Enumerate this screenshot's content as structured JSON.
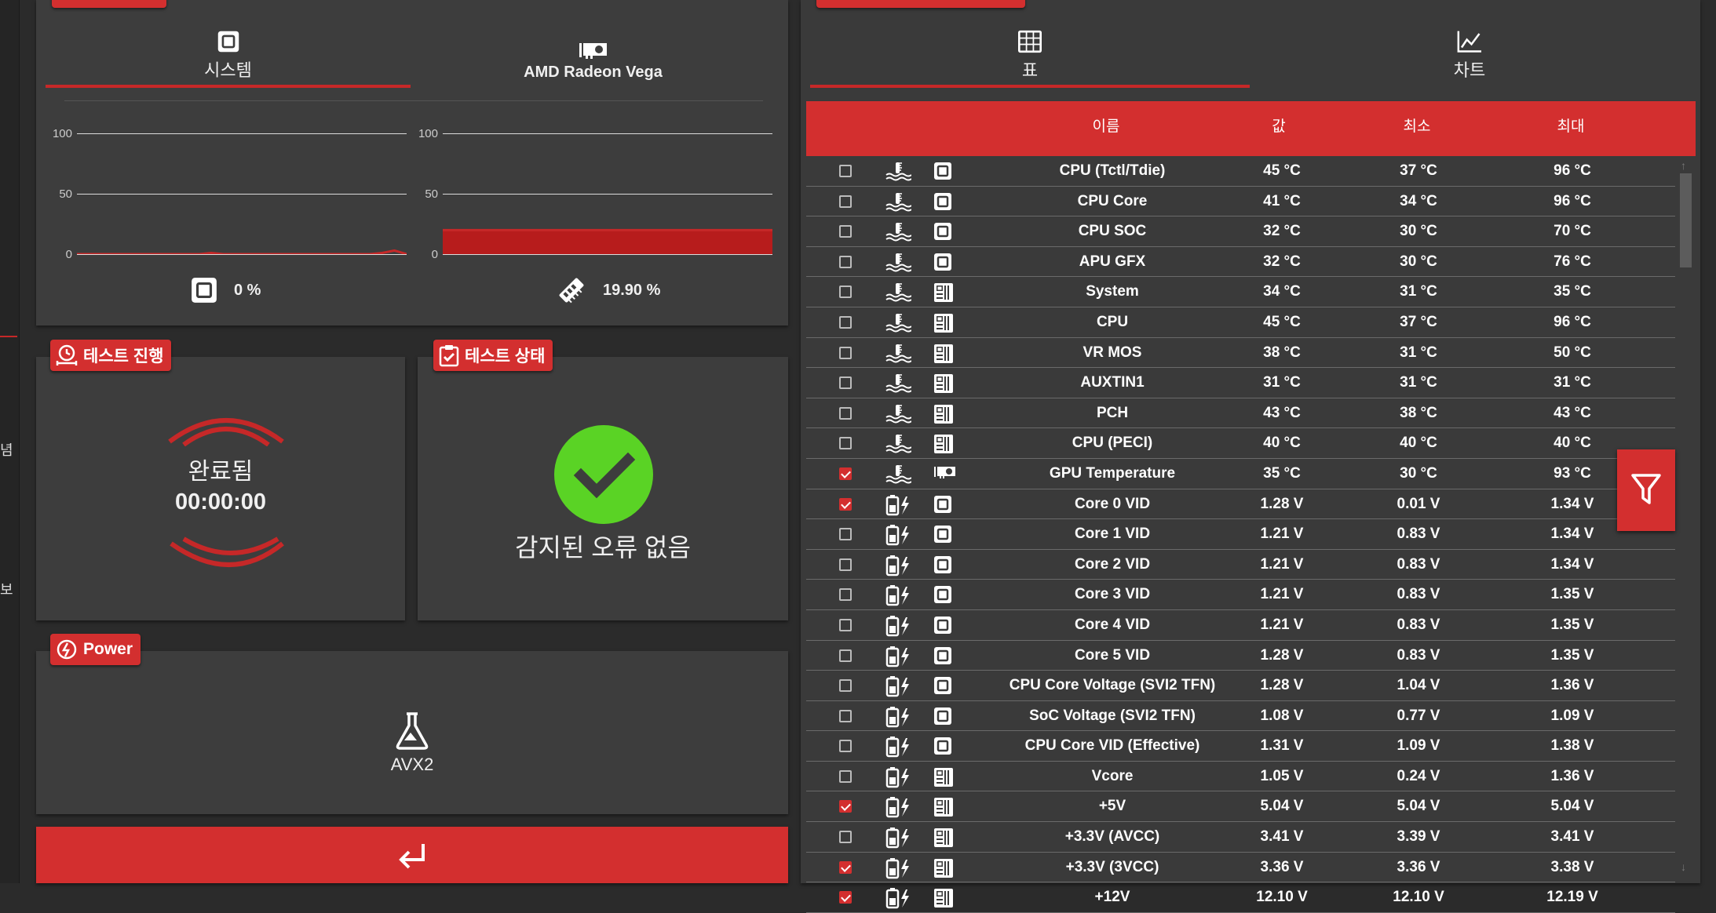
{
  "left_strip": {
    "chars": [
      "념",
      "보"
    ]
  },
  "monitor": {
    "tabs": [
      {
        "label": "시스템",
        "icon": "cpu-chip-icon",
        "active": true
      },
      {
        "label": "AMD Radeon Vega",
        "icon": "gpu-card-icon",
        "active": false
      }
    ],
    "chart_data": [
      {
        "type": "line",
        "yticks": [
          "100",
          "50",
          "0"
        ],
        "ylim": [
          0,
          100
        ],
        "values": [
          0,
          0,
          0,
          0,
          0,
          0,
          0,
          0,
          0,
          0,
          0,
          1,
          0,
          0,
          0,
          0,
          0,
          0,
          0,
          0,
          0,
          0,
          0,
          0,
          0,
          1,
          3,
          0
        ],
        "color": "#c62828"
      },
      {
        "type": "area",
        "yticks": [
          "100",
          "50",
          "0"
        ],
        "ylim": [
          0,
          100
        ],
        "values": [
          19.9,
          19.9,
          19.9,
          19.9,
          19.9,
          19.9,
          19.9,
          19.9,
          19.9,
          19.9
        ],
        "color": "#c62828"
      }
    ],
    "readouts": [
      {
        "icon": "cpu-chip-icon",
        "value": "0 %"
      },
      {
        "icon": "memory-stick-icon",
        "value": "19.90 %"
      }
    ]
  },
  "test_progress": {
    "title": "테스트 진행",
    "status": "완료됨",
    "time": "00:00:00"
  },
  "test_status": {
    "title": "테스트 상태",
    "message": "감지된 오류 없음",
    "ok_color": "#5ad325"
  },
  "power": {
    "title": "Power",
    "mode": "AVX2"
  },
  "accent": "#d32f2f",
  "sensors": {
    "tabs": [
      {
        "label": "표",
        "icon": "table-grid-icon",
        "active": true
      },
      {
        "label": "차트",
        "icon": "line-chart-icon",
        "active": false
      }
    ],
    "columns": {
      "name": "이름",
      "value": "값",
      "min": "최소",
      "max": "최대"
    },
    "rows": [
      {
        "checked": false,
        "type": "temperature",
        "source": "cpu",
        "name": "CPU (Tctl/Tdie)",
        "value": "45 °C",
        "min": "37 °C",
        "max": "96 °C"
      },
      {
        "checked": false,
        "type": "temperature",
        "source": "cpu",
        "name": "CPU Core",
        "value": "41 °C",
        "min": "34 °C",
        "max": "96 °C"
      },
      {
        "checked": false,
        "type": "temperature",
        "source": "cpu",
        "name": "CPU SOC",
        "value": "32 °C",
        "min": "30 °C",
        "max": "70 °C"
      },
      {
        "checked": false,
        "type": "temperature",
        "source": "cpu",
        "name": "APU GFX",
        "value": "32 °C",
        "min": "30 °C",
        "max": "76 °C"
      },
      {
        "checked": false,
        "type": "temperature",
        "source": "board",
        "name": "System",
        "value": "34 °C",
        "min": "31 °C",
        "max": "35 °C"
      },
      {
        "checked": false,
        "type": "temperature",
        "source": "board",
        "name": "CPU",
        "value": "45 °C",
        "min": "37 °C",
        "max": "96 °C"
      },
      {
        "checked": false,
        "type": "temperature",
        "source": "board",
        "name": "VR MOS",
        "value": "38 °C",
        "min": "31 °C",
        "max": "50 °C"
      },
      {
        "checked": false,
        "type": "temperature",
        "source": "board",
        "name": "AUXTIN1",
        "value": "31 °C",
        "min": "31 °C",
        "max": "31 °C"
      },
      {
        "checked": false,
        "type": "temperature",
        "source": "board",
        "name": "PCH",
        "value": "43 °C",
        "min": "38 °C",
        "max": "43 °C"
      },
      {
        "checked": false,
        "type": "temperature",
        "source": "board",
        "name": "CPU (PECI)",
        "value": "40 °C",
        "min": "40 °C",
        "max": "40 °C"
      },
      {
        "checked": true,
        "type": "temperature",
        "source": "gpu",
        "name": "GPU Temperature",
        "value": "35 °C",
        "min": "30 °C",
        "max": "93 °C"
      },
      {
        "checked": true,
        "type": "voltage",
        "source": "cpu",
        "name": "Core 0 VID",
        "value": "1.28 V",
        "min": "0.01 V",
        "max": "1.34 V"
      },
      {
        "checked": false,
        "type": "voltage",
        "source": "cpu",
        "name": "Core 1 VID",
        "value": "1.21 V",
        "min": "0.83 V",
        "max": "1.34 V"
      },
      {
        "checked": false,
        "type": "voltage",
        "source": "cpu",
        "name": "Core 2 VID",
        "value": "1.21 V",
        "min": "0.83 V",
        "max": "1.34 V"
      },
      {
        "checked": false,
        "type": "voltage",
        "source": "cpu",
        "name": "Core 3 VID",
        "value": "1.21 V",
        "min": "0.83 V",
        "max": "1.35 V"
      },
      {
        "checked": false,
        "type": "voltage",
        "source": "cpu",
        "name": "Core 4 VID",
        "value": "1.21 V",
        "min": "0.83 V",
        "max": "1.35 V"
      },
      {
        "checked": false,
        "type": "voltage",
        "source": "cpu",
        "name": "Core 5 VID",
        "value": "1.28 V",
        "min": "0.83 V",
        "max": "1.35 V"
      },
      {
        "checked": false,
        "type": "voltage",
        "source": "cpu",
        "name": "CPU Core Voltage (SVI2 TFN)",
        "value": "1.28 V",
        "min": "1.04 V",
        "max": "1.36 V"
      },
      {
        "checked": false,
        "type": "voltage",
        "source": "cpu",
        "name": "SoC Voltage (SVI2 TFN)",
        "value": "1.08 V",
        "min": "0.77 V",
        "max": "1.09 V"
      },
      {
        "checked": false,
        "type": "voltage",
        "source": "cpu",
        "name": "CPU Core VID (Effective)",
        "value": "1.31 V",
        "min": "1.09 V",
        "max": "1.38 V"
      },
      {
        "checked": false,
        "type": "voltage",
        "source": "board",
        "name": "Vcore",
        "value": "1.05 V",
        "min": "0.24 V",
        "max": "1.36 V"
      },
      {
        "checked": true,
        "type": "voltage",
        "source": "board",
        "name": "+5V",
        "value": "5.04 V",
        "min": "5.04 V",
        "max": "5.04 V"
      },
      {
        "checked": false,
        "type": "voltage",
        "source": "board",
        "name": "+3.3V (AVCC)",
        "value": "3.41 V",
        "min": "3.39 V",
        "max": "3.41 V"
      },
      {
        "checked": true,
        "type": "voltage",
        "source": "board",
        "name": "+3.3V (3VCC)",
        "value": "3.36 V",
        "min": "3.36 V",
        "max": "3.38 V"
      },
      {
        "checked": true,
        "type": "voltage",
        "source": "board",
        "name": "+12V",
        "value": "12.10 V",
        "min": "12.10 V",
        "max": "12.19 V"
      }
    ]
  }
}
